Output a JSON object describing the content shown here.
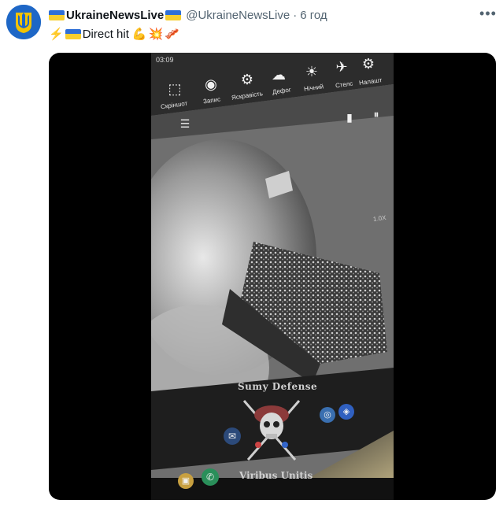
{
  "author": {
    "display_name": "UkraineNewsLive",
    "handle": "@UkraineNewsLive",
    "separator": "·",
    "time": "6 год",
    "avatar_icon": "ukraine-trident-icon"
  },
  "more_icon": "more-horizontal-icon",
  "tweet": {
    "lead_emoji": "⚡",
    "text": "Direct hit",
    "emojis": [
      "💪",
      "💥",
      "🥓"
    ]
  },
  "video": {
    "clock": "03:09",
    "toolbar": [
      {
        "label": "Скріншот",
        "icon": "screenshot-icon"
      },
      {
        "label": "Запис",
        "icon": "record-icon"
      },
      {
        "label": "Яскравість",
        "icon": "brightness-icon"
      },
      {
        "label": "Дефог",
        "icon": "defog-icon"
      },
      {
        "label": "Нічний",
        "icon": "night-mode-icon"
      },
      {
        "label": "Стелс",
        "icon": "stealth-icon"
      },
      {
        "label": "Налашт",
        "icon": "settings-icon"
      }
    ],
    "zoom": "1.0X",
    "watermark_top": "Sumy Defense",
    "watermark_bottom": "Viribus Unitis"
  },
  "colors": {
    "flag_blue": "#2f6fd6",
    "flag_yellow": "#f7ce2e",
    "avatar_bg": "#1e67c6"
  }
}
